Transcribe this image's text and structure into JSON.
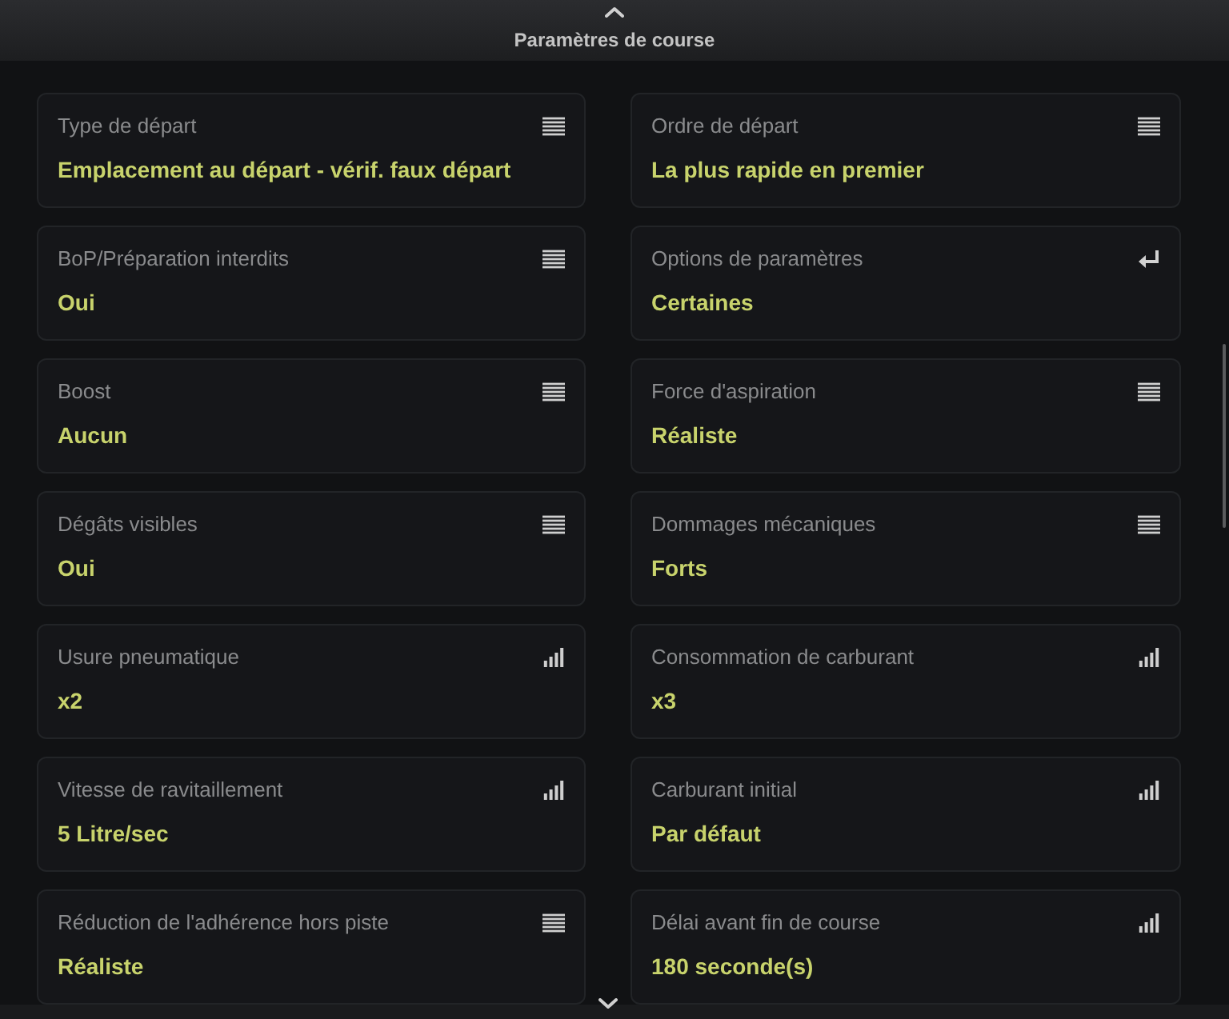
{
  "header": {
    "title": "Paramètres de course"
  },
  "settings": [
    {
      "label": "Type de départ",
      "value": "Emplacement au départ - vérif. faux départ",
      "kind": "list"
    },
    {
      "label": "Ordre de départ",
      "value": "La plus rapide en premier",
      "kind": "list"
    },
    {
      "label": "BoP/Préparation interdits",
      "value": "Oui",
      "kind": "list"
    },
    {
      "label": "Options de paramètres",
      "value": "Certaines",
      "kind": "enter"
    },
    {
      "label": "Boost",
      "value": "Aucun",
      "kind": "list"
    },
    {
      "label": "Force d'aspiration",
      "value": "Réaliste",
      "kind": "list"
    },
    {
      "label": "Dégâts visibles",
      "value": "Oui",
      "kind": "list"
    },
    {
      "label": "Dommages mécaniques",
      "value": "Forts",
      "kind": "list"
    },
    {
      "label": "Usure pneumatique",
      "value": "x2",
      "kind": "bars"
    },
    {
      "label": "Consommation de carburant",
      "value": "x3",
      "kind": "bars"
    },
    {
      "label": "Vitesse de ravitaillement",
      "value": "5 Litre/sec",
      "kind": "bars"
    },
    {
      "label": "Carburant initial",
      "value": "Par défaut",
      "kind": "bars"
    },
    {
      "label": "Réduction de l'adhérence hors piste",
      "value": "Réaliste",
      "kind": "list"
    },
    {
      "label": "Délai avant fin de course",
      "value": "180 seconde(s)",
      "kind": "bars"
    }
  ]
}
